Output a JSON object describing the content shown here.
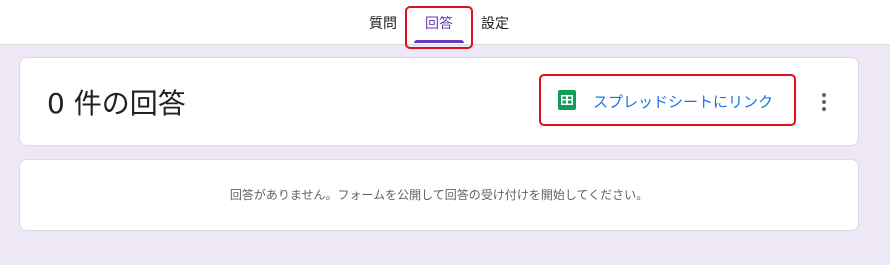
{
  "tabs": [
    {
      "label": "質問"
    },
    {
      "label": "回答",
      "active": true
    },
    {
      "label": "設定"
    }
  ],
  "summary": {
    "title": "0 件の回答",
    "link_label": "スプレッドシートにリンク",
    "link_icon": "google-sheets-icon",
    "more_icon": "more-vert-icon"
  },
  "empty_state": {
    "message": "回答がありません。フォームを公開して回答の受け付けを開始してください。"
  },
  "colors": {
    "accent": "#673ab7",
    "link": "#1a73e8",
    "sheets_green": "#0f9d58",
    "highlight_red": "#e0101a",
    "background": "#ede7f6"
  }
}
